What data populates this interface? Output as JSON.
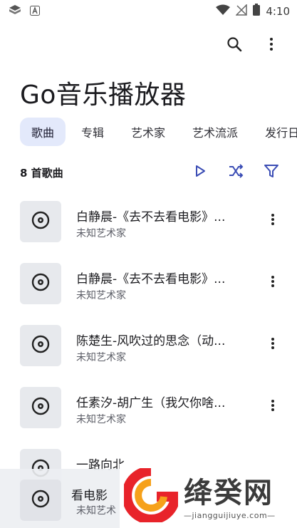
{
  "status_bar": {
    "time": "4:10"
  },
  "app": {
    "title": "Go音乐播放器"
  },
  "tabs": [
    {
      "label": "歌曲",
      "active": true
    },
    {
      "label": "专辑",
      "active": false
    },
    {
      "label": "艺术家",
      "active": false
    },
    {
      "label": "艺术流派",
      "active": false
    },
    {
      "label": "发行日期",
      "active": false
    }
  ],
  "songs_header": {
    "count": "8 首歌曲"
  },
  "songs": [
    {
      "title": "白静晨-《去不去看电影》...",
      "artist": "未知艺术家"
    },
    {
      "title": "白静晨-《去不去看电影》...",
      "artist": "未知艺术家"
    },
    {
      "title": "陈楚生-风吹过的思念（动...",
      "artist": "未知艺术家"
    },
    {
      "title": "任素汐-胡广生（我欠你啥...",
      "artist": "未知艺术家"
    },
    {
      "title": "一路向北",
      "artist": ""
    }
  ],
  "now_playing": {
    "title": "看电影",
    "artist": "未知艺术"
  },
  "watermark": {
    "brand": "绛癸网",
    "url": "—jiangguijiuye.com—"
  },
  "colors": {
    "accent": "#3b4db5",
    "tab_active_bg": "#e3e9fb",
    "cover_bg": "#e7e9ed"
  }
}
